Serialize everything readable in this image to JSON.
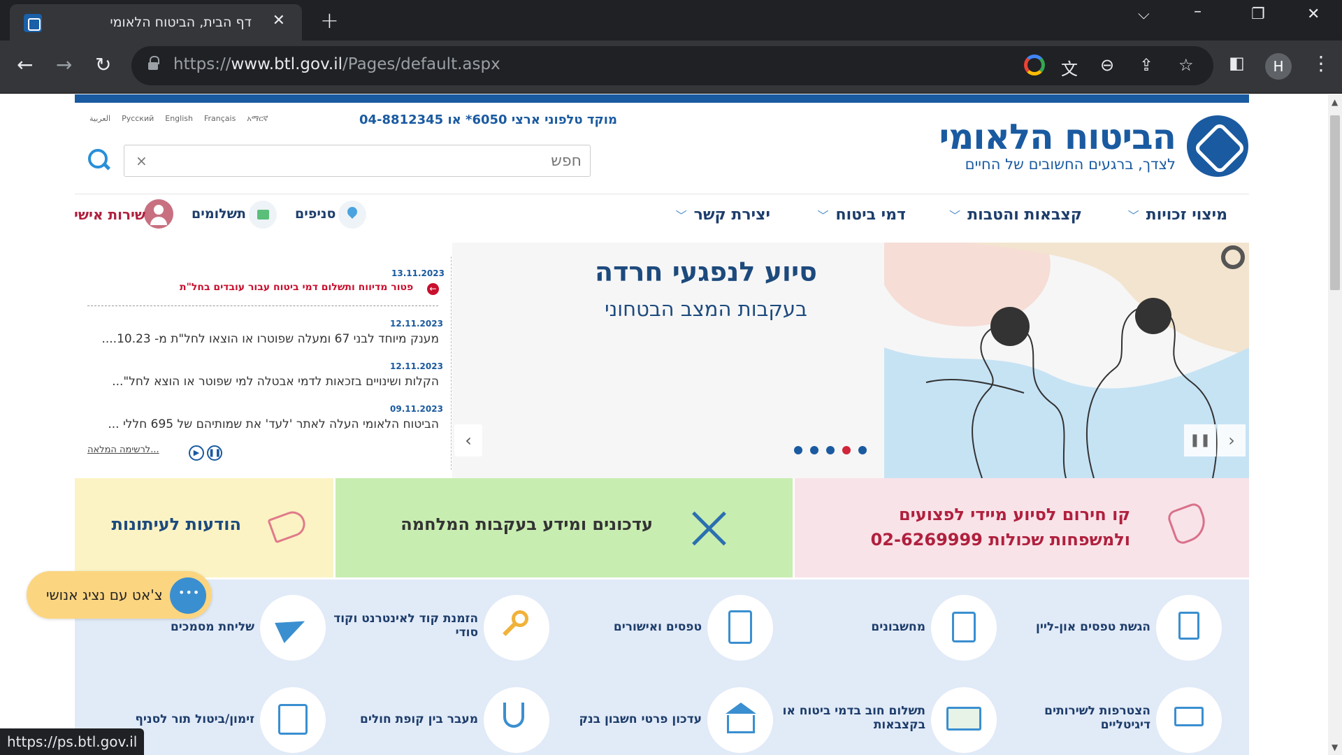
{
  "browser": {
    "tab_title": "דף הבית, הביטוח הלאומי",
    "new_tab": "+",
    "url_prefix": "https://",
    "url_host": "www.btl.gov.il",
    "url_path": "/Pages/default.aspx",
    "profile_initial": "H",
    "status_url": "https://ps.btl.gov.il"
  },
  "header": {
    "logo_title": "הביטוח הלאומי",
    "logo_subtitle": "לצדך, ברגעים החשובים של החיים",
    "languages": [
      "العربية",
      "Русский",
      "English",
      "Français",
      "አማርኛ"
    ],
    "hotline": "מוקד טלפוני ארצי 6050* או 04-8812345",
    "search_placeholder": "חפש"
  },
  "nav": {
    "items": [
      "מיצוי זכויות",
      "קצבאות והטבות",
      "דמי ביטוח",
      "יצירת קשר"
    ],
    "branches": "סניפים",
    "payments": "תשלומים",
    "personal": "שירות אישי"
  },
  "hero": {
    "title": "סיוע לנפגעי חרדה",
    "subtitle": "בעקבות המצב הבטחוני",
    "slide_count": 5,
    "active_slide": 4
  },
  "news": {
    "items": [
      {
        "date": "13.11.2023",
        "text": "פטור מדיווח ותשלום דמי ביטוח עבור עובדים בחל\"ת"
      },
      {
        "date": "12.11.2023",
        "text": "מענק מיוחד לבני 67 ומעלה שפוטרו או הוצאו לחל\"ת מ- 10.23...."
      },
      {
        "date": "12.11.2023",
        "text": "הקלות ושינויים בזכאות לדמי אבטלה למי שפוטר או הוצא לחל\"..."
      },
      {
        "date": "09.11.2023",
        "text": "הביטוח הלאומי העלה לאתר 'לעד' את שמותיהם של 695 חללי ..."
      }
    ],
    "more_link": "לרשימה המלאה..."
  },
  "cards": {
    "hotline_line1": "קו חירום לסיוע מיידי לפצועים",
    "hotline_line2": "ולמשפחות שכולות 02-6269999",
    "war_updates": "עדכונים ומידע בעקבות המלחמה",
    "press": "הודעות לעיתונות"
  },
  "services": [
    {
      "label": "הגשת טפסים און-ליין",
      "icon": "form-submit-icon"
    },
    {
      "label": "מחשבונים",
      "icon": "calculator-icon"
    },
    {
      "label": "טפסים ואישורים",
      "icon": "clipboard-icon"
    },
    {
      "label": "הזמנת קוד לאינטרנט וקוד סודי",
      "icon": "key-icon"
    },
    {
      "label": "שליחת מסמכים",
      "icon": "paper-plane-icon"
    },
    {
      "label": "הצטרפות לשירותים דיגיטליים",
      "icon": "laptop-icon"
    },
    {
      "label": "תשלום חוב בדמי ביטוח או בקצבאות",
      "icon": "money-icon"
    },
    {
      "label": "עדכון פרטי חשבון בנק",
      "icon": "bank-icon"
    },
    {
      "label": "מעבר בין קופת חולים",
      "icon": "stethoscope-icon"
    },
    {
      "label": "זימון/ביטול תור לסניף",
      "icon": "calendar-icon"
    }
  ],
  "chat": {
    "label": "צ'אט עם נציג אנושי"
  },
  "colors": {
    "brand_blue": "#1a5aa0",
    "alert_red": "#c8102e",
    "card_pink": "#f8e3e8",
    "card_green": "#c8edb0",
    "card_yellow": "#fbf3c4",
    "service_bg": "#e1eaf7",
    "chat_yellow": "#fcd580"
  }
}
